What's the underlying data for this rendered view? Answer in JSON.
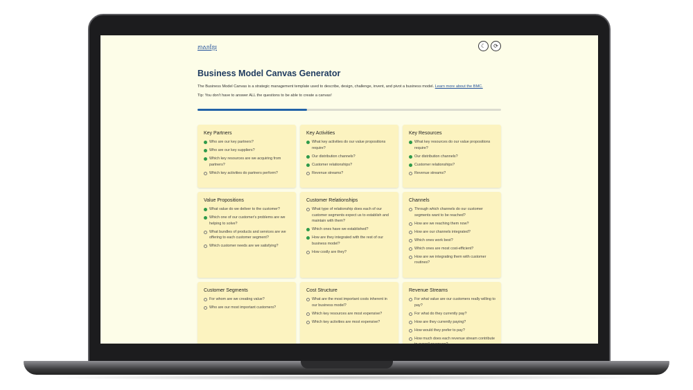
{
  "header": {
    "logo_text": "ភាសាខ្មែរ",
    "theme_icon": "moon-icon",
    "reset_icon": "refresh-icon"
  },
  "page": {
    "title": "Business Model Canvas Generator",
    "description": "The Business Model Canvas is a strategic management template used to describe, design, challenge, invent, and pivot a business model.",
    "link_text": "Learn more about the BMC.",
    "tip": "Tip: You don't have to answer ALL the questions to be able to create a canvas!",
    "progress": 0.36
  },
  "colors": {
    "accent": "#2363a8",
    "card_bg": "#fcf3c0",
    "page_bg": "#fdfde8",
    "done": "#2e9a4a"
  },
  "cards": [
    {
      "title": "Key Partners",
      "row": 1,
      "questions": [
        {
          "text": "Who are our key partners?",
          "done": true
        },
        {
          "text": "Who are our key suppliers?",
          "done": true
        },
        {
          "text": "Which key resources are we acquiring from partners?",
          "done": true
        },
        {
          "text": "Which key activities do partners perform?",
          "done": false
        }
      ]
    },
    {
      "title": "Key Activities",
      "row": 1,
      "questions": [
        {
          "text": "What key activities do our value propositions require?",
          "done": true
        },
        {
          "text": "Our distribution channels?",
          "done": true
        },
        {
          "text": "Customer relationships?",
          "done": true
        },
        {
          "text": "Revenue streams?",
          "done": false
        }
      ]
    },
    {
      "title": "Key Resources",
      "row": 1,
      "questions": [
        {
          "text": "What key resources do our value propositions require?",
          "done": true
        },
        {
          "text": "Our distribution channels?",
          "done": true
        },
        {
          "text": "Customer relationships?",
          "done": true
        },
        {
          "text": "Revenue streams?",
          "done": false
        }
      ]
    },
    {
      "title": "Value Propositions",
      "row": 2,
      "questions": [
        {
          "text": "What value do we deliver to the customer?",
          "done": true
        },
        {
          "text": "Which one of our customer's problems are we helping to solve?",
          "done": true
        },
        {
          "text": "What bundles of products and services are we offering to each customer segment?",
          "done": false
        },
        {
          "text": "Which customer needs are we satisfying?",
          "done": false
        }
      ]
    },
    {
      "title": "Customer Relationships",
      "row": 2,
      "questions": [
        {
          "text": "What type of relationship does each of our customer segments expect us to establish and maintain with them?",
          "done": false
        },
        {
          "text": "Which ones have we established?",
          "done": true
        },
        {
          "text": "How are they integrated with the rest of our business model?",
          "done": true
        },
        {
          "text": "How costly are they?",
          "done": false
        }
      ]
    },
    {
      "title": "Channels",
      "row": 2,
      "questions": [
        {
          "text": "Through which channels do our customer segments want to be reached?",
          "done": false
        },
        {
          "text": "How are we reaching them now?",
          "done": false
        },
        {
          "text": "How are our channels integrated?",
          "done": false
        },
        {
          "text": "Which ones work best?",
          "done": false
        },
        {
          "text": "Which ones are most cost-efficient?",
          "done": false
        },
        {
          "text": "How are we integrating them with customer routines?",
          "done": false
        }
      ]
    },
    {
      "title": "Customer Segments",
      "row": 3,
      "questions": [
        {
          "text": "For whom are we creating value?",
          "done": false
        },
        {
          "text": "Who are our most important customers?",
          "done": false
        }
      ]
    },
    {
      "title": "Cost Structure",
      "row": 3,
      "questions": [
        {
          "text": "What are the most important costs inherent in our business model?",
          "done": false
        },
        {
          "text": "Which key resources are most expensive?",
          "done": false
        },
        {
          "text": "Which key activities are most expensive?",
          "done": false
        }
      ]
    },
    {
      "title": "Revenue Streams",
      "row": 3,
      "questions": [
        {
          "text": "For what value are our customers really willing to pay?",
          "done": false
        },
        {
          "text": "For what do they currently pay?",
          "done": false
        },
        {
          "text": "How are they currently paying?",
          "done": false
        },
        {
          "text": "How would they prefer to pay?",
          "done": false
        },
        {
          "text": "How much does each revenue stream contribute to overall revenues?",
          "done": false
        }
      ]
    }
  ]
}
